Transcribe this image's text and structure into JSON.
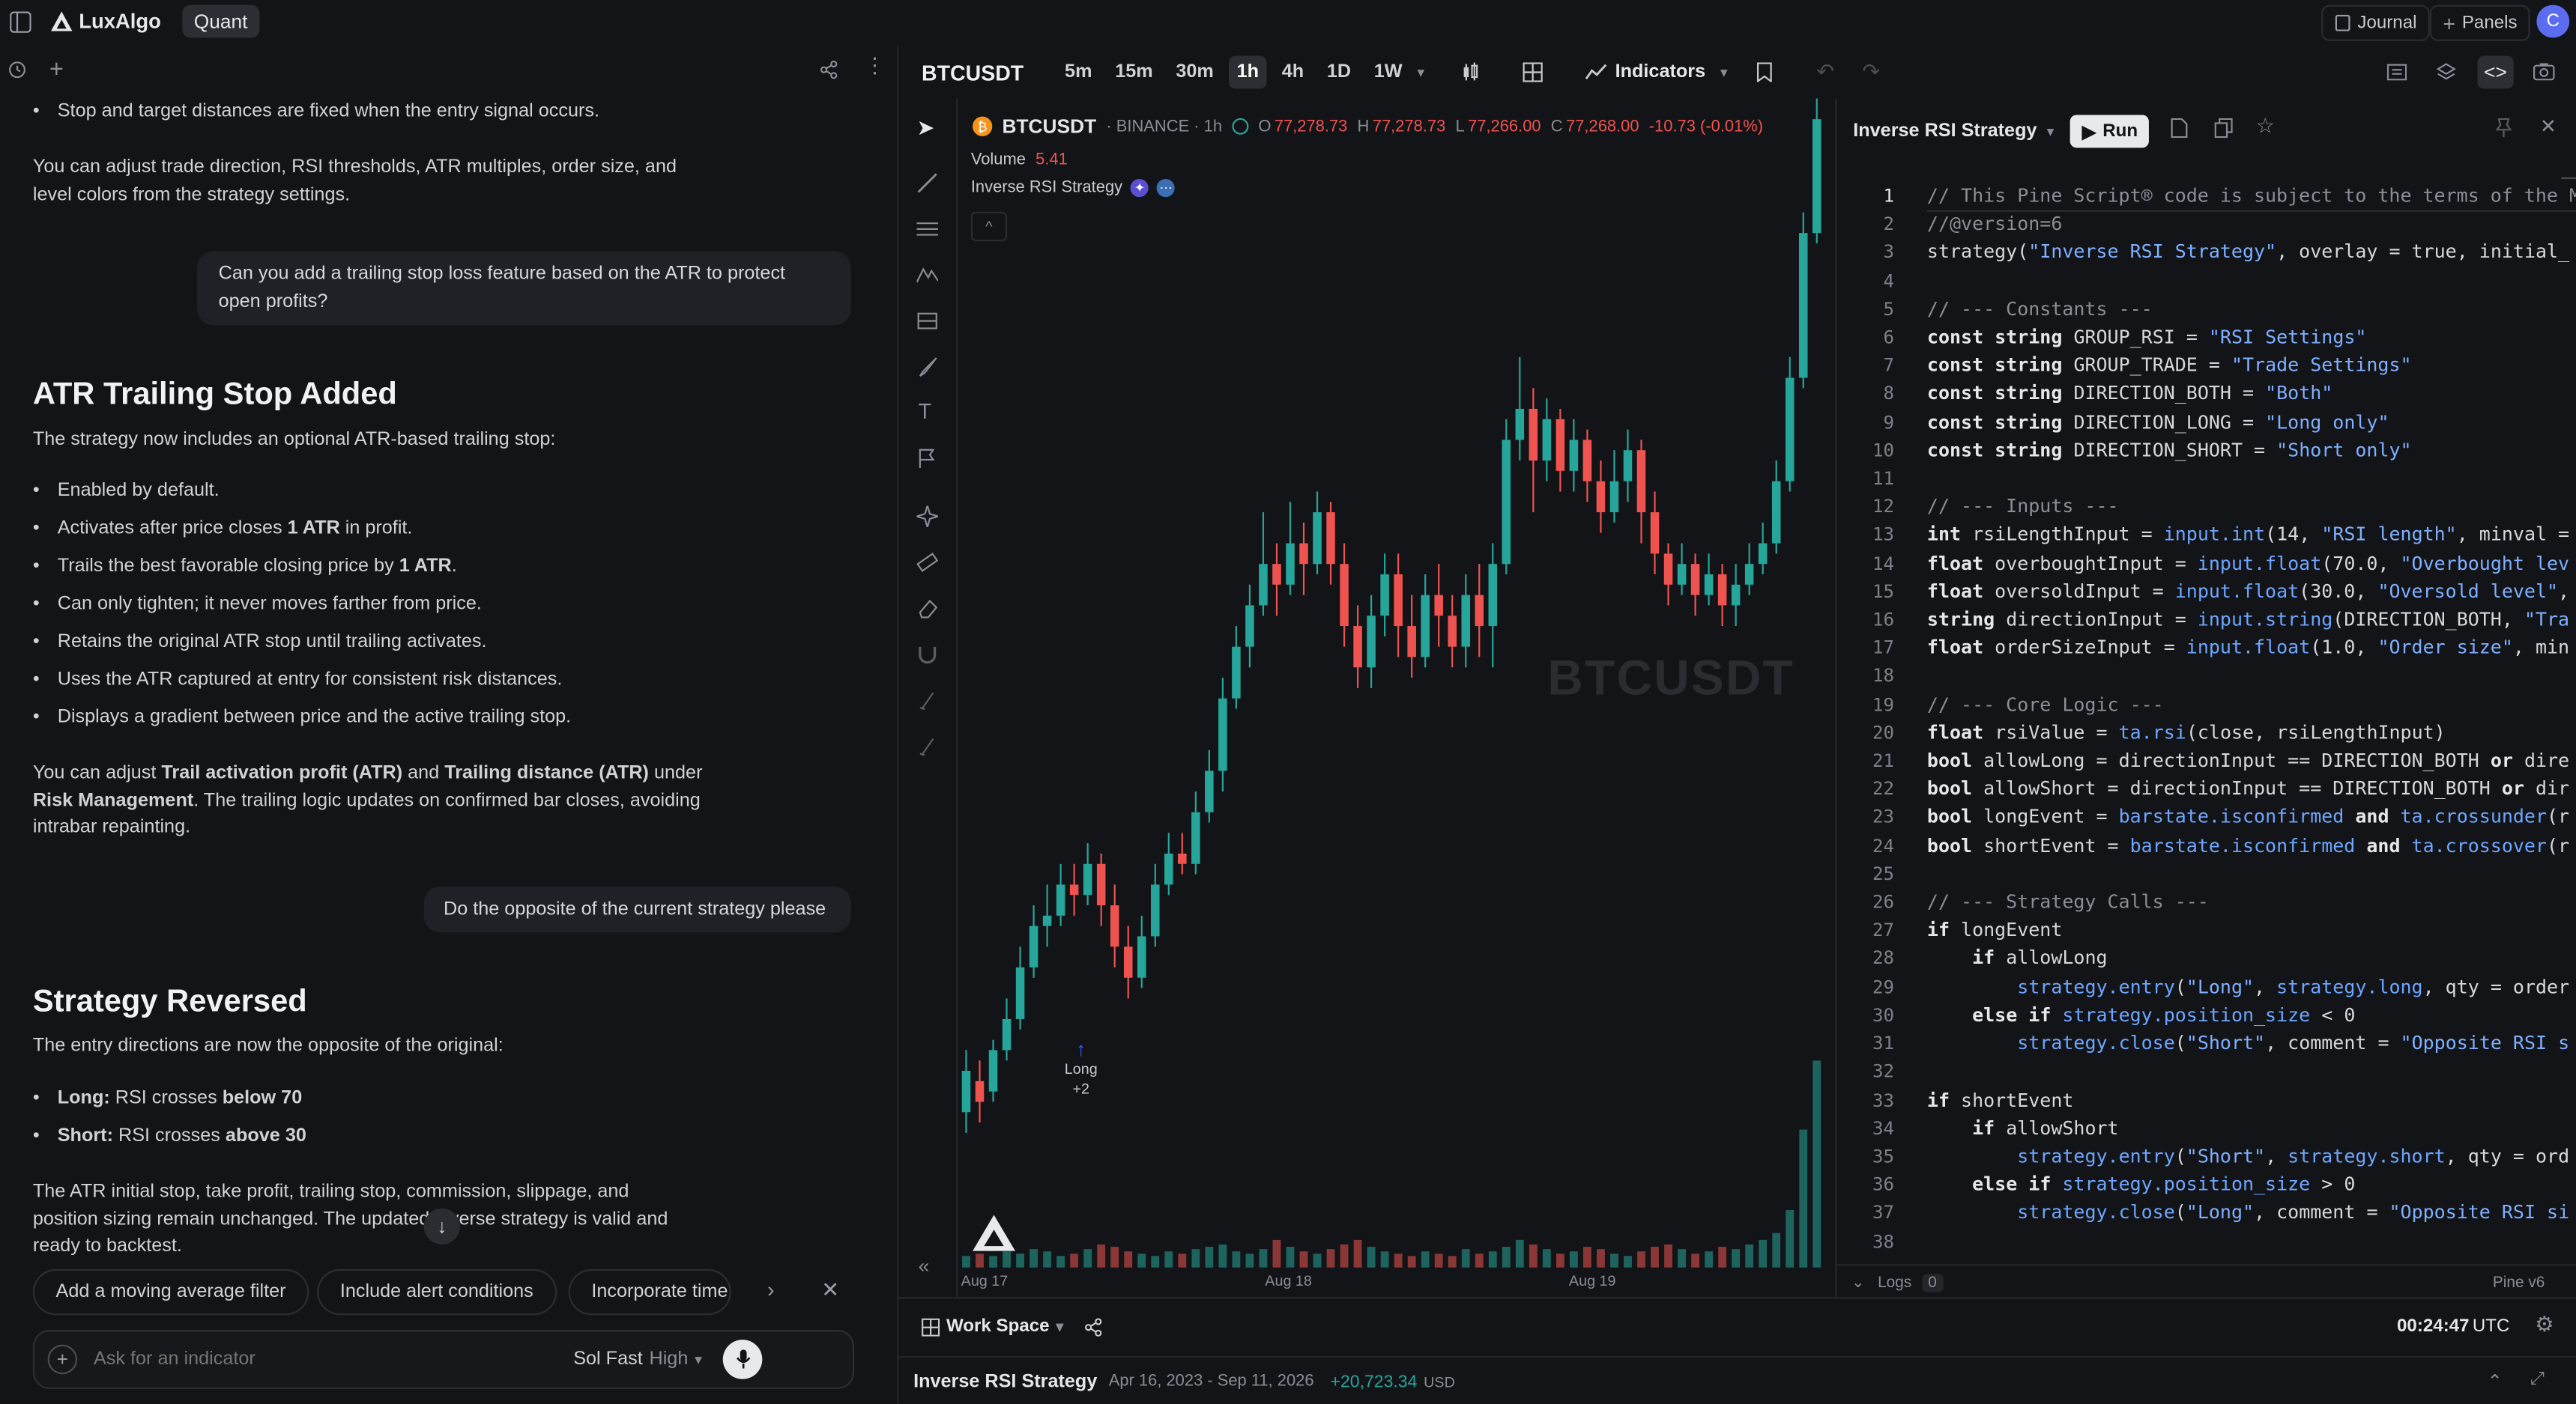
{
  "topbar": {
    "brand": "LuxAlgo",
    "mode": "Quant",
    "journal": "Journal",
    "panels": "Panels",
    "avatar": "C"
  },
  "chat": {
    "p_stop": "Stop and target distances are fixed when the entry signal occurs.",
    "p_adjust": "You can adjust trade direction, RSI thresholds, ATR multiples, order size, and level colors from the strategy settings.",
    "user_q1": "Can you add a trailing stop loss feature based on the ATR to protect open profits?",
    "h_atr": "ATR Trailing Stop Added",
    "p_atr_intro": "The strategy now includes an optional ATR-based trailing stop:",
    "b1": "Enabled by default.",
    "b2_pre": "Activates after price closes ",
    "b2_bold": "1 ATR",
    "b2_post": " in profit.",
    "b3_pre": "Trails the best favorable closing price by ",
    "b3_bold": "1 ATR",
    "b3_post": ".",
    "b4": "Can only tighten; it never moves farther from price.",
    "b5": "Retains the original ATR stop until trailing activates.",
    "b6": "Uses the ATR captured at entry for consistent risk distances.",
    "b7": "Displays a gradient between price and the active trailing stop.",
    "p_trail_1": "You can adjust ",
    "p_trail_b1": "Trail activation profit (ATR)",
    "p_trail_2": " and ",
    "p_trail_b2": "Trailing distance (ATR)",
    "p_trail_3": " under ",
    "p_trail_b3": "Risk Management",
    "p_trail_4": ". The trailing logic updates on confirmed bar closes, avoiding intrabar repainting.",
    "user_q2": "Do the opposite of the current strategy please",
    "h_rev": "Strategy Reversed",
    "p_rev_intro": "The entry directions are now the opposite of the original:",
    "long_label": "Long:",
    "long_mid": " RSI crosses ",
    "long_bold": "below 70",
    "short_label": "Short:",
    "short_mid": " RSI crosses ",
    "short_bold": "above 30",
    "p_rev_end": "The ATR initial stop, take profit, trailing stop, commission, slippage, and position sizing remain unchanged. The updated inverse strategy is valid and ready to backtest.",
    "chips": [
      "Add a moving average filter",
      "Include alert conditions",
      "Incorporate time s"
    ],
    "input_placeholder": "Ask for an indicator",
    "model": "Sol Fast",
    "effort": "High"
  },
  "chartbar": {
    "symbol": "BTCUSDT",
    "timeframes": [
      "5m",
      "15m",
      "30m",
      "1h",
      "4h",
      "1D",
      "1W"
    ],
    "active_tf": "1h",
    "indicators": "Indicators"
  },
  "legend": {
    "symbol": "BTCUSDT",
    "exchange": "· BINANCE · 1h",
    "o_label": "O",
    "o": "77,278.73",
    "h_label": "H",
    "h": "77,278.73",
    "l_label": "L",
    "l": "77,266.00",
    "c_label": "C",
    "c": "77,268.00",
    "chg": "-10.73 (-0.01%)",
    "volume_label": "Volume",
    "volume": "5.41",
    "strategy": "Inverse RSI Strategy",
    "watermark": "BTCUSDT",
    "signal_label": "Long",
    "signal_qty": "+2",
    "x_labels": [
      "Aug 17",
      "Aug 18",
      "Aug 19"
    ]
  },
  "chart_data": {
    "type": "candlestick",
    "symbol": "BTCUSDT",
    "interval": "1h",
    "x_ticks": [
      "Aug 17",
      "Aug 18",
      "Aug 19"
    ],
    "candles": [
      {
        "o": 0.02,
        "c": 0.06,
        "h": 0.08,
        "l": 0.0
      },
      {
        "o": 0.05,
        "c": 0.03,
        "h": 0.07,
        "l": 0.01
      },
      {
        "o": 0.04,
        "c": 0.08,
        "h": 0.09,
        "l": 0.03
      },
      {
        "o": 0.08,
        "c": 0.11,
        "h": 0.13,
        "l": 0.07
      },
      {
        "o": 0.11,
        "c": 0.16,
        "h": 0.18,
        "l": 0.1
      },
      {
        "o": 0.16,
        "c": 0.2,
        "h": 0.22,
        "l": 0.15
      },
      {
        "o": 0.2,
        "c": 0.21,
        "h": 0.24,
        "l": 0.18
      },
      {
        "o": 0.21,
        "c": 0.24,
        "h": 0.26,
        "l": 0.2
      },
      {
        "o": 0.24,
        "c": 0.23,
        "h": 0.26,
        "l": 0.21
      },
      {
        "o": 0.23,
        "c": 0.26,
        "h": 0.28,
        "l": 0.22
      },
      {
        "o": 0.26,
        "c": 0.22,
        "h": 0.27,
        "l": 0.2
      },
      {
        "o": 0.22,
        "c": 0.18,
        "h": 0.24,
        "l": 0.16
      },
      {
        "o": 0.18,
        "c": 0.15,
        "h": 0.2,
        "l": 0.13
      },
      {
        "o": 0.15,
        "c": 0.19,
        "h": 0.21,
        "l": 0.14
      },
      {
        "o": 0.19,
        "c": 0.24,
        "h": 0.26,
        "l": 0.18
      },
      {
        "o": 0.24,
        "c": 0.27,
        "h": 0.29,
        "l": 0.23
      },
      {
        "o": 0.27,
        "c": 0.26,
        "h": 0.29,
        "l": 0.25
      },
      {
        "o": 0.26,
        "c": 0.31,
        "h": 0.33,
        "l": 0.25
      },
      {
        "o": 0.31,
        "c": 0.35,
        "h": 0.37,
        "l": 0.3
      },
      {
        "o": 0.35,
        "c": 0.42,
        "h": 0.44,
        "l": 0.33
      },
      {
        "o": 0.42,
        "c": 0.47,
        "h": 0.49,
        "l": 0.41
      },
      {
        "o": 0.47,
        "c": 0.51,
        "h": 0.53,
        "l": 0.45
      },
      {
        "o": 0.51,
        "c": 0.55,
        "h": 0.6,
        "l": 0.5
      },
      {
        "o": 0.55,
        "c": 0.53,
        "h": 0.57,
        "l": 0.5
      },
      {
        "o": 0.53,
        "c": 0.57,
        "h": 0.61,
        "l": 0.52
      },
      {
        "o": 0.57,
        "c": 0.55,
        "h": 0.59,
        "l": 0.52
      },
      {
        "o": 0.55,
        "c": 0.6,
        "h": 0.62,
        "l": 0.54
      },
      {
        "o": 0.6,
        "c": 0.55,
        "h": 0.61,
        "l": 0.53
      },
      {
        "o": 0.55,
        "c": 0.49,
        "h": 0.57,
        "l": 0.47
      },
      {
        "o": 0.49,
        "c": 0.45,
        "h": 0.51,
        "l": 0.43
      },
      {
        "o": 0.45,
        "c": 0.5,
        "h": 0.52,
        "l": 0.43
      },
      {
        "o": 0.5,
        "c": 0.54,
        "h": 0.56,
        "l": 0.48
      },
      {
        "o": 0.54,
        "c": 0.49,
        "h": 0.56,
        "l": 0.46
      },
      {
        "o": 0.49,
        "c": 0.46,
        "h": 0.52,
        "l": 0.44
      },
      {
        "o": 0.46,
        "c": 0.52,
        "h": 0.54,
        "l": 0.45
      },
      {
        "o": 0.52,
        "c": 0.5,
        "h": 0.55,
        "l": 0.47
      },
      {
        "o": 0.5,
        "c": 0.47,
        "h": 0.52,
        "l": 0.45
      },
      {
        "o": 0.47,
        "c": 0.52,
        "h": 0.54,
        "l": 0.45
      },
      {
        "o": 0.52,
        "c": 0.49,
        "h": 0.55,
        "l": 0.46
      },
      {
        "o": 0.49,
        "c": 0.55,
        "h": 0.57,
        "l": 0.45
      },
      {
        "o": 0.55,
        "c": 0.67,
        "h": 0.69,
        "l": 0.54
      },
      {
        "o": 0.67,
        "c": 0.7,
        "h": 0.75,
        "l": 0.65
      },
      {
        "o": 0.7,
        "c": 0.65,
        "h": 0.72,
        "l": 0.6
      },
      {
        "o": 0.65,
        "c": 0.69,
        "h": 0.71,
        "l": 0.63
      },
      {
        "o": 0.69,
        "c": 0.64,
        "h": 0.7,
        "l": 0.62
      },
      {
        "o": 0.64,
        "c": 0.67,
        "h": 0.69,
        "l": 0.62
      },
      {
        "o": 0.67,
        "c": 0.63,
        "h": 0.68,
        "l": 0.61
      },
      {
        "o": 0.63,
        "c": 0.6,
        "h": 0.65,
        "l": 0.58
      },
      {
        "o": 0.6,
        "c": 0.63,
        "h": 0.66,
        "l": 0.59
      },
      {
        "o": 0.63,
        "c": 0.66,
        "h": 0.68,
        "l": 0.61
      },
      {
        "o": 0.66,
        "c": 0.6,
        "h": 0.67,
        "l": 0.57
      },
      {
        "o": 0.6,
        "c": 0.56,
        "h": 0.62,
        "l": 0.54
      },
      {
        "o": 0.56,
        "c": 0.53,
        "h": 0.57,
        "l": 0.51
      },
      {
        "o": 0.53,
        "c": 0.55,
        "h": 0.57,
        "l": 0.52
      },
      {
        "o": 0.55,
        "c": 0.52,
        "h": 0.56,
        "l": 0.5
      },
      {
        "o": 0.52,
        "c": 0.54,
        "h": 0.56,
        "l": 0.51
      },
      {
        "o": 0.54,
        "c": 0.51,
        "h": 0.55,
        "l": 0.49
      },
      {
        "o": 0.51,
        "c": 0.53,
        "h": 0.55,
        "l": 0.49
      },
      {
        "o": 0.53,
        "c": 0.55,
        "h": 0.57,
        "l": 0.52
      },
      {
        "o": 0.55,
        "c": 0.57,
        "h": 0.59,
        "l": 0.54
      },
      {
        "o": 0.57,
        "c": 0.63,
        "h": 0.65,
        "l": 0.56
      },
      {
        "o": 0.63,
        "c": 0.73,
        "h": 0.75,
        "l": 0.62
      },
      {
        "o": 0.73,
        "c": 0.87,
        "h": 0.89,
        "l": 0.72
      },
      {
        "o": 0.87,
        "c": 0.98,
        "h": 1.0,
        "l": 0.86
      }
    ],
    "volume": [
      0.05,
      0.06,
      0.05,
      0.07,
      0.06,
      0.08,
      0.07,
      0.05,
      0.06,
      0.08,
      0.1,
      0.09,
      0.07,
      0.06,
      0.05,
      0.07,
      0.06,
      0.08,
      0.09,
      0.1,
      0.07,
      0.06,
      0.08,
      0.12,
      0.09,
      0.07,
      0.06,
      0.08,
      0.1,
      0.12,
      0.09,
      0.07,
      0.06,
      0.05,
      0.07,
      0.06,
      0.05,
      0.08,
      0.06,
      0.07,
      0.09,
      0.12,
      0.1,
      0.08,
      0.06,
      0.07,
      0.09,
      0.08,
      0.06,
      0.05,
      0.07,
      0.09,
      0.1,
      0.08,
      0.06,
      0.07,
      0.09,
      0.08,
      0.1,
      0.12,
      0.15,
      0.25,
      0.6,
      0.9
    ]
  },
  "editor": {
    "title": "Inverse RSI Strategy",
    "run": "Run",
    "logs": "Logs",
    "logs_count": "0",
    "lang": "Pine v6",
    "lines": [
      "// This Pine Script® code is subject to the terms of the M",
      "//@version=6",
      "strategy(\"Inverse RSI Strategy\", overlay = true, initial_",
      "",
      "// --- Constants ---",
      "const string GROUP_RSI = \"RSI Settings\"",
      "const string GROUP_TRADE = \"Trade Settings\"",
      "const string DIRECTION_BOTH = \"Both\"",
      "const string DIRECTION_LONG = \"Long only\"",
      "const string DIRECTION_SHORT = \"Short only\"",
      "",
      "// --- Inputs ---",
      "int rsiLengthInput = input.int(14, \"RSI length\", minval =",
      "float overboughtInput = input.float(70.0, \"Overbought lev",
      "float oversoldInput = input.float(30.0, \"Oversold level\",",
      "string directionInput = input.string(DIRECTION_BOTH, \"Tra",
      "float orderSizeInput = input.float(1.0, \"Order size\", min",
      "",
      "// --- Core Logic ---",
      "float rsiValue = ta.rsi(close, rsiLengthInput)",
      "bool allowLong = directionInput == DIRECTION_BOTH or dire",
      "bool allowShort = directionInput == DIRECTION_BOTH or dir",
      "bool longEvent = barstate.isconfirmed and ta.crossunder(r",
      "bool shortEvent = barstate.isconfirmed and ta.crossover(r",
      "",
      "// --- Strategy Calls ---",
      "if longEvent",
      "    if allowLong",
      "        strategy.entry(\"Long\", strategy.long, qty = order",
      "    else if strategy.position_size < 0",
      "        strategy.close(\"Short\", comment = \"Opposite RSI s",
      "",
      "if shortEvent",
      "    if allowShort",
      "        strategy.entry(\"Short\", strategy.short, qty = ord",
      "    else if strategy.position_size > 0",
      "        strategy.close(\"Long\", comment = \"Opposite RSI si",
      ""
    ]
  },
  "bottom": {
    "workspace": "Work Space",
    "time": "00:24:47",
    "tz": "UTC"
  },
  "strategybar": {
    "name": "Inverse RSI Strategy",
    "range": "Apr 16, 2023 - Sep 11, 2026",
    "pnl": "+20,723.34",
    "currency": "USD"
  },
  "colors": {
    "up": "#26a69a",
    "down": "#ef5350",
    "accent": "#2962ff",
    "pnl": "#26a69a"
  }
}
